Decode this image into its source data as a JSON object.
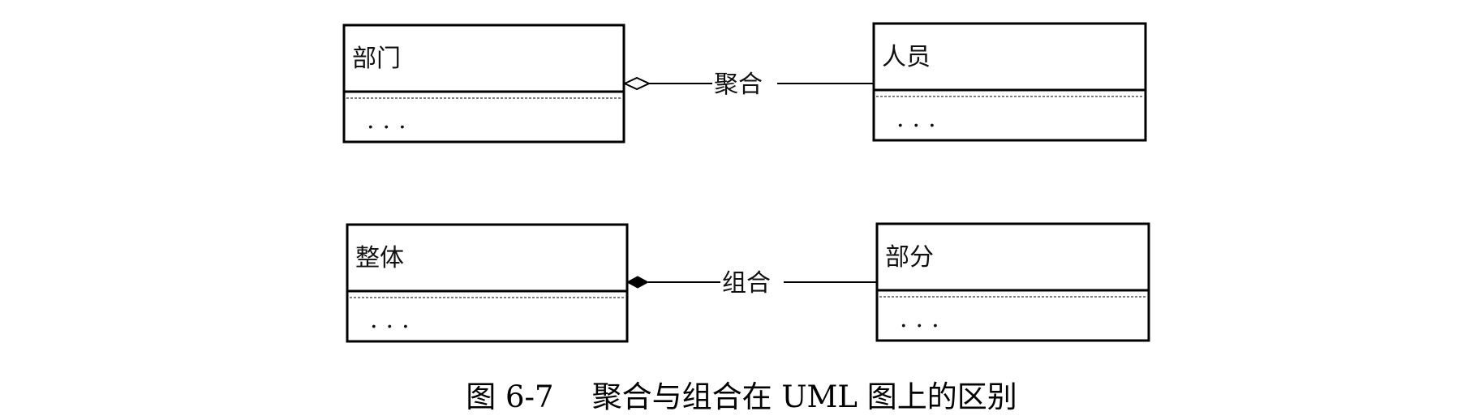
{
  "diagram": {
    "classes": {
      "department": {
        "name": "部门",
        "attributes": "..."
      },
      "staff": {
        "name": "人员",
        "attributes": "..."
      },
      "whole": {
        "name": "整体",
        "attributes": "..."
      },
      "part": {
        "name": "部分",
        "attributes": "..."
      }
    },
    "relations": {
      "aggregation": {
        "label": "聚合",
        "marker": "hollow-diamond"
      },
      "composition": {
        "label": "组合",
        "marker": "filled-diamond"
      }
    },
    "caption": "图 6-7    聚合与组合在 UML 图上的区别",
    "colors": {
      "line": "#000000",
      "background": "#ffffff"
    }
  }
}
